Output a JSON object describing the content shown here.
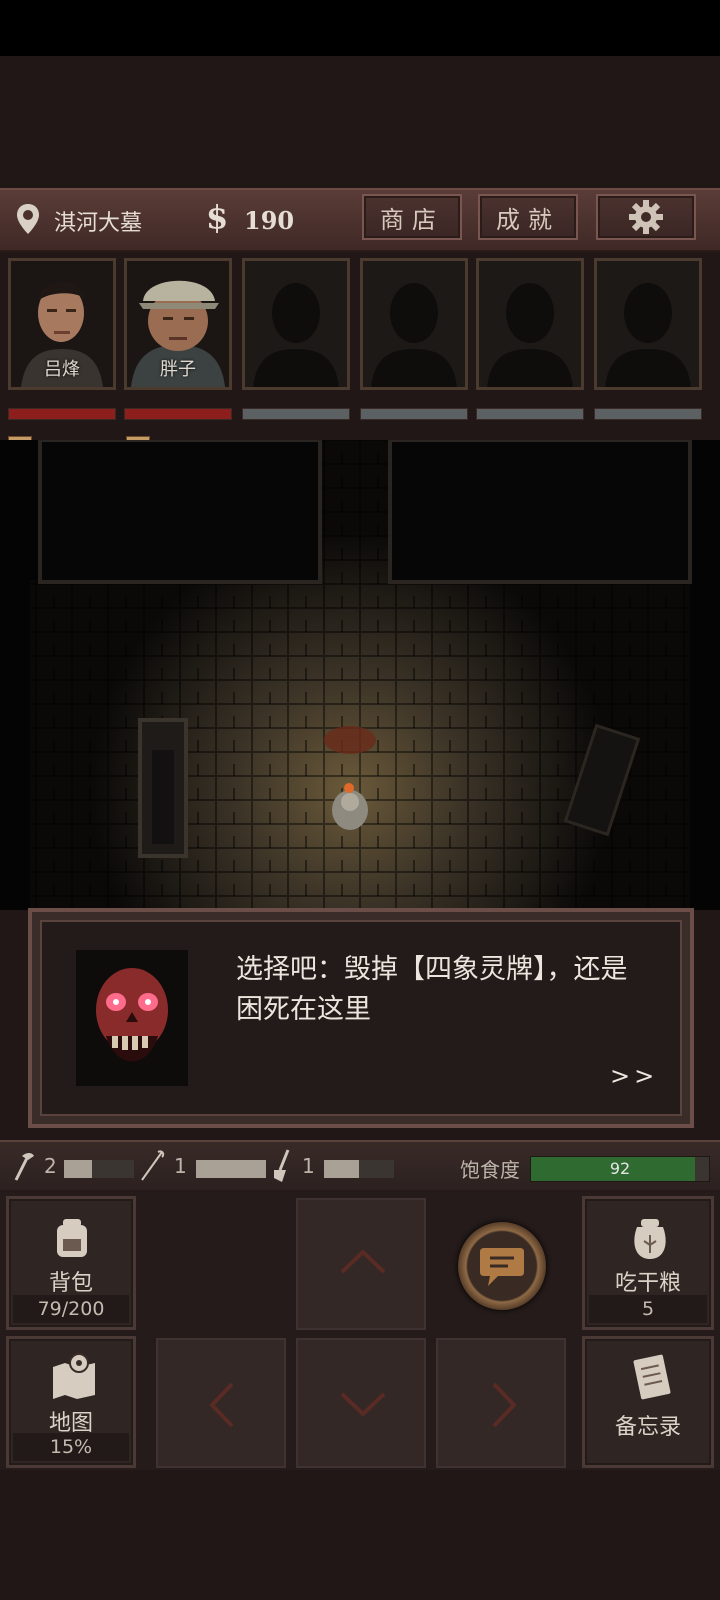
{
  "header": {
    "location": "淇河大墓",
    "currency_symbol": "$",
    "money": "190",
    "shop_label": "商店",
    "achievements_label": "成就",
    "settings_icon": "gear-icon"
  },
  "party": [
    {
      "name": "吕烽",
      "hp": 1.0,
      "status": "饱"
    },
    {
      "name": "胖子",
      "hp": 1.0,
      "status": "饱"
    },
    {
      "name": "",
      "hp": 0
    },
    {
      "name": "",
      "hp": 0
    },
    {
      "name": "",
      "hp": 0
    },
    {
      "name": "",
      "hp": 0
    }
  ],
  "dialog": {
    "text": "选择吧：毁掉【四象灵牌】，还是困死在这里",
    "next_label": ">>",
    "speaker_icon": "red-skull-portrait"
  },
  "tools": {
    "axe_count": "2",
    "axe_level": 0.4,
    "rope_count": "1",
    "rope_level": 1.0,
    "shovel_count": "1",
    "shovel_level": 0.5
  },
  "hunger": {
    "label": "饱食度",
    "value": "92",
    "level": 0.92
  },
  "controls": {
    "backpack_label": "背包",
    "backpack_count": "79/200",
    "ration_label": "吃干粮",
    "ration_count": "5",
    "map_label": "地图",
    "map_progress": "15%",
    "memo_label": "备忘录"
  },
  "colors": {
    "hp_full": "#8c1f1c",
    "hp_empty": "#5b6062",
    "hunger_fill": "#2f6a30",
    "panel_bg": "#2f2523"
  }
}
